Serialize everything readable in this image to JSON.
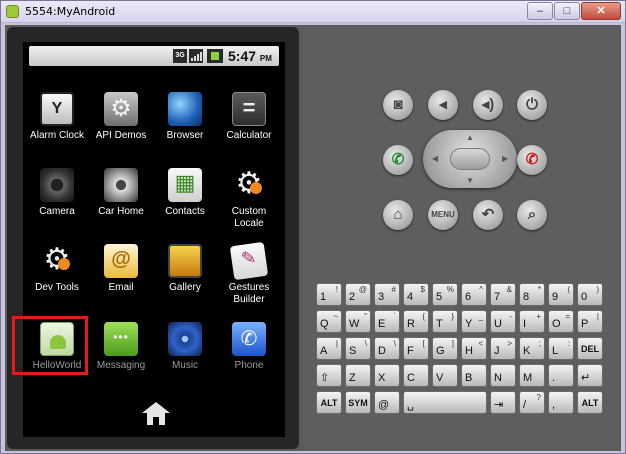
{
  "window": {
    "title": "5554:MyAndroid",
    "minimize_label": "–",
    "maximize_label": "□",
    "close_label": "✕"
  },
  "statusbar": {
    "network": "3G",
    "time": "5:47",
    "ampm": "PM"
  },
  "apps": [
    {
      "label": "Alarm Clock",
      "icon": "alarm-clock-icon"
    },
    {
      "label": "API Demos",
      "icon": "api-demos-icon"
    },
    {
      "label": "Browser",
      "icon": "browser-globe-icon"
    },
    {
      "label": "Calculator",
      "icon": "calculator-icon"
    },
    {
      "label": "Camera",
      "icon": "camera-icon"
    },
    {
      "label": "Car Home",
      "icon": "car-home-icon"
    },
    {
      "label": "Contacts",
      "icon": "contacts-icon"
    },
    {
      "label": "Custom Locale",
      "icon": "custom-locale-icon"
    },
    {
      "label": "Dev Tools",
      "icon": "dev-tools-icon"
    },
    {
      "label": "Email",
      "icon": "email-icon"
    },
    {
      "label": "Gallery",
      "icon": "gallery-icon"
    },
    {
      "label": "Gestures Builder",
      "icon": "gestures-builder-icon"
    },
    {
      "label": "HelloWorld",
      "icon": "helloworld-icon"
    },
    {
      "label": "Messaging",
      "icon": "messaging-icon"
    },
    {
      "label": "Music",
      "icon": "music-icon"
    },
    {
      "label": "Phone",
      "icon": "phone-icon"
    }
  ],
  "controls": {
    "menu_label": "MENU"
  },
  "keyboard": {
    "row1": [
      {
        "main": "1",
        "alt": "!"
      },
      {
        "main": "2",
        "alt": "@"
      },
      {
        "main": "3",
        "alt": "#"
      },
      {
        "main": "4",
        "alt": "$"
      },
      {
        "main": "5",
        "alt": "%"
      },
      {
        "main": "6",
        "alt": "^"
      },
      {
        "main": "7",
        "alt": "&"
      },
      {
        "main": "8",
        "alt": "*"
      },
      {
        "main": "9",
        "alt": "("
      },
      {
        "main": "0",
        "alt": ")"
      }
    ],
    "row2": [
      {
        "main": "Q",
        "alt": "~"
      },
      {
        "main": "W",
        "alt": "\""
      },
      {
        "main": "E",
        "alt": "`"
      },
      {
        "main": "R",
        "alt": "{"
      },
      {
        "main": "T",
        "alt": "}"
      },
      {
        "main": "Y",
        "alt": "_"
      },
      {
        "main": "U",
        "alt": "-"
      },
      {
        "main": "I",
        "alt": "+"
      },
      {
        "main": "O",
        "alt": "="
      },
      {
        "main": "P",
        "alt": "|"
      }
    ],
    "row3": [
      {
        "main": "A",
        "alt": "|"
      },
      {
        "main": "S",
        "alt": "\\"
      },
      {
        "main": "D",
        "alt": "\\"
      },
      {
        "main": "F",
        "alt": "["
      },
      {
        "main": "G",
        "alt": "]"
      },
      {
        "main": "H",
        "alt": "<"
      },
      {
        "main": "J",
        "alt": ">"
      },
      {
        "main": "K",
        "alt": ";"
      },
      {
        "main": "L",
        "alt": ":"
      },
      {
        "main": "DEL",
        "alt": ""
      }
    ],
    "row4": [
      {
        "main": "⇧",
        "alt": ""
      },
      {
        "main": "Z",
        "alt": ""
      },
      {
        "main": "X",
        "alt": ""
      },
      {
        "main": "C",
        "alt": ""
      },
      {
        "main": "V",
        "alt": ""
      },
      {
        "main": "B",
        "alt": ""
      },
      {
        "main": "N",
        "alt": ""
      },
      {
        "main": "M",
        "alt": ""
      },
      {
        "main": ".",
        "alt": ""
      },
      {
        "main": "↵",
        "alt": ""
      }
    ],
    "row5": [
      {
        "main": "ALT",
        "alt": ""
      },
      {
        "main": "SYM",
        "alt": ""
      },
      {
        "main": "@",
        "alt": ""
      },
      {
        "main": "␣",
        "alt": ""
      },
      {
        "main": "⇥",
        "alt": ""
      },
      {
        "main": "/",
        "alt": "?"
      },
      {
        "main": ",",
        "alt": ""
      },
      {
        "main": "ALT",
        "alt": ""
      }
    ]
  }
}
